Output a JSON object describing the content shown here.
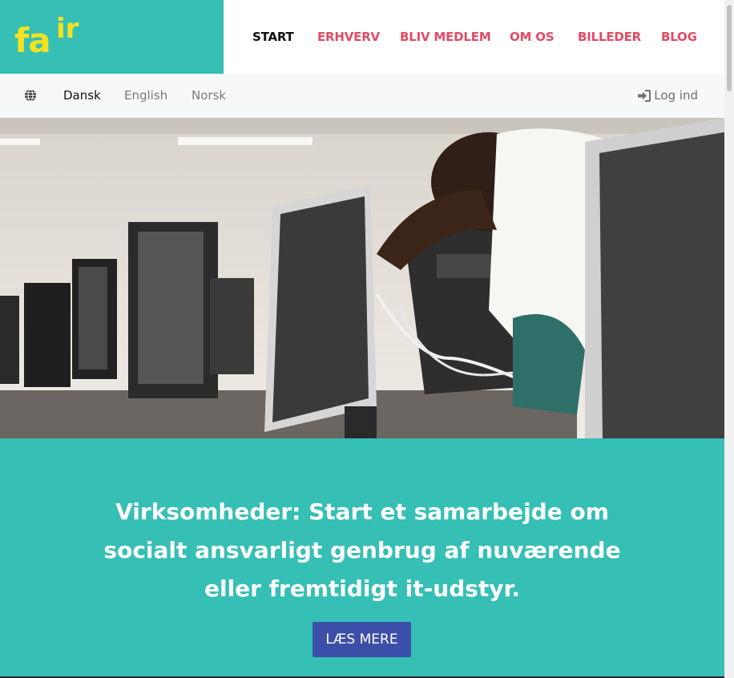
{
  "brand": {
    "logo_part1": "fa",
    "logo_part2": "ir"
  },
  "nav": {
    "items": [
      {
        "label": "START",
        "active": true
      },
      {
        "label": "ERHVERV"
      },
      {
        "label": "BLIV MEDLEM"
      },
      {
        "label": "OM OS"
      },
      {
        "label": "BILLEDER"
      },
      {
        "label": "BLOG"
      }
    ]
  },
  "languages": {
    "icon": "globe-icon",
    "items": [
      {
        "label": "Dansk",
        "active": true
      },
      {
        "label": "English"
      },
      {
        "label": "Norsk"
      }
    ]
  },
  "login": {
    "icon": "sign-in-icon",
    "label": "Log ind"
  },
  "hero": {
    "image": "computer-lab-photo"
  },
  "cta": {
    "text": "Virksomheder: Start et samarbejde om socialt ansvarligt genbrug af nuværende eller fremtidigt it-udstyr.",
    "button_label": "LÆS MERE"
  },
  "colors": {
    "teal": "#36bfb5",
    "logo_yellow": "#f4e21f",
    "nav_red": "#e34a63",
    "button_blue": "#3c4fa8"
  }
}
